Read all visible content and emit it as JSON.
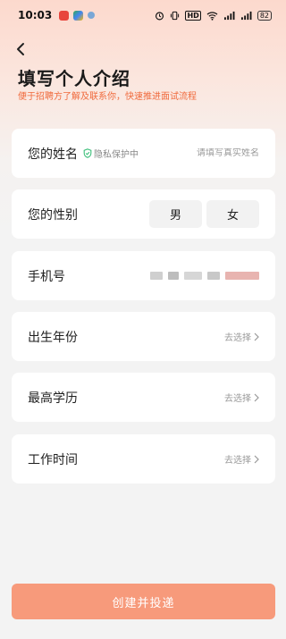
{
  "status_bar": {
    "time": "10:03",
    "network_badge": "HD",
    "battery": "82",
    "app_icons": [
      "red-app-icon",
      "play-store-icon",
      "small-app-icon"
    ],
    "right_icons": [
      "alarm-icon",
      "vibrate-icon",
      "hd-badge",
      "wifi-icon",
      "signal-icon",
      "signal-icon",
      "battery-icon"
    ]
  },
  "header": {
    "back_icon": "chevron-left-icon",
    "title": "填写个人介绍",
    "subtitle": "便于招聘方了解及联系你，快速推进面试流程"
  },
  "form": {
    "name": {
      "label": "您的姓名",
      "privacy_label": "隐私保护中",
      "placeholder": "请填写真实姓名"
    },
    "gender": {
      "label": "您的性别",
      "options": [
        "男",
        "女"
      ]
    },
    "phone": {
      "label": "手机号"
    },
    "birth": {
      "label": "出生年份",
      "action": "去选择"
    },
    "education": {
      "label": "最高学历",
      "action": "去选择"
    },
    "work_time": {
      "label": "工作时间",
      "action": "去选择"
    }
  },
  "submit": {
    "label": "创建并投递"
  },
  "colors": {
    "accent": "#f06a3c",
    "button": "#f79a7b",
    "privacy_green": "#3cbf7a"
  }
}
